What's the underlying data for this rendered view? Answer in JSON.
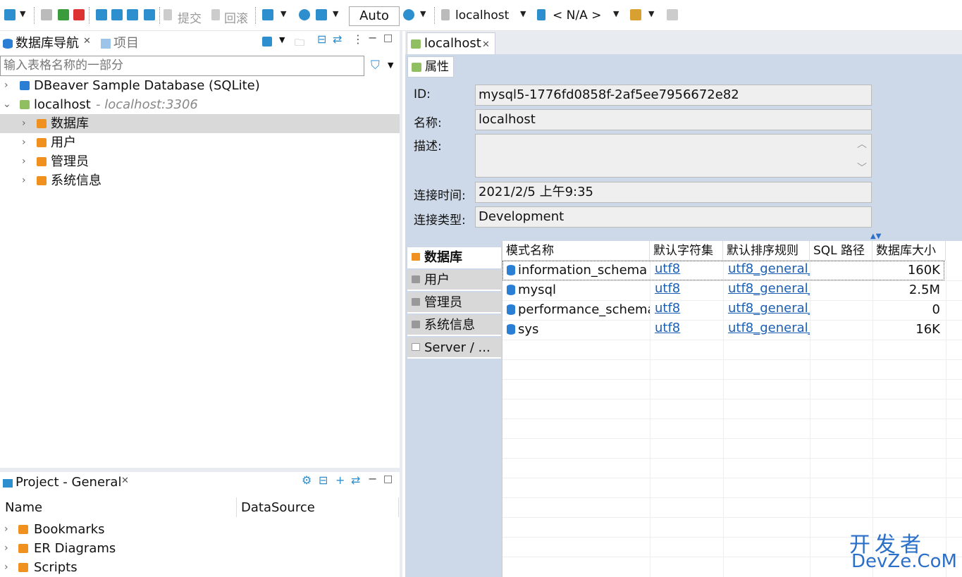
{
  "toolbar": {
    "commit_label": "提交",
    "rollback_label": "回滚",
    "auto_label": "Auto",
    "connection_label": "localhost",
    "schema_label": "< N/A >"
  },
  "nav": {
    "tab_db_nav": "数据库导航",
    "tab_projects": "项目",
    "filter_placeholder": "输入表格名称的一部分",
    "tree": [
      {
        "label": "DBeaver Sample Database (SQLite)"
      },
      {
        "label": "localhost",
        "hint": "- localhost:3306"
      },
      {
        "label": "数据库"
      },
      {
        "label": "用户"
      },
      {
        "label": "管理员"
      },
      {
        "label": "系统信息"
      }
    ]
  },
  "project": {
    "title": "Project - General",
    "col_name": "Name",
    "col_datasource": "DataSource",
    "items": [
      "Bookmarks",
      "ER Diagrams",
      "Scripts"
    ]
  },
  "editor": {
    "tab_label": "localhost",
    "sub_tab_label": "属性",
    "props": {
      "id_label": "ID:",
      "id_value": "mysql5-1776fd0858f-2af5ee7956672e82",
      "name_label": "名称:",
      "name_value": "localhost",
      "desc_label": "描述:",
      "desc_value": "",
      "conn_time_label": "连接时间:",
      "conn_time_value": "2021/2/5 上午9:35",
      "conn_type_label": "连接类型:",
      "conn_type_value": "Development"
    },
    "vtabs": [
      "数据库",
      "用户",
      "管理员",
      "系统信息",
      "Server / ..."
    ],
    "table": {
      "headers": [
        "模式名称",
        "默认字符集",
        "默认排序规则",
        "SQL 路径",
        "数据库大小"
      ],
      "rows": [
        {
          "name": "information_schema",
          "charset": "utf8",
          "collation": "utf8_general_",
          "path": "",
          "size": "160K"
        },
        {
          "name": "mysql",
          "charset": "utf8",
          "collation": "utf8_general_",
          "path": "",
          "size": "2.5M"
        },
        {
          "name": "performance_schema",
          "charset": "utf8",
          "collation": "utf8_general_",
          "path": "",
          "size": "0"
        },
        {
          "name": "sys",
          "charset": "utf8",
          "collation": "utf8_general_",
          "path": "",
          "size": "16K"
        }
      ]
    }
  },
  "watermark": {
    "line1": "开发者",
    "line2": "DevZe.CoM"
  },
  "colors": {
    "accent": "#1a5fb4",
    "folder": "#f0901e",
    "editor_bg": "#cdd9e8"
  }
}
